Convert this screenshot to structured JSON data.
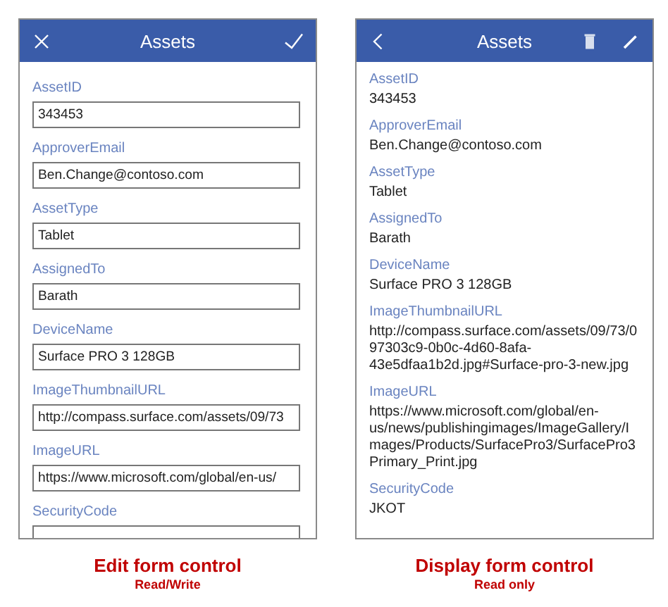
{
  "panels": [
    {
      "kind": "edit",
      "title": "Assets",
      "left_icon": {
        "kind": "close"
      },
      "right_icons": [
        {
          "kind": "check"
        }
      ],
      "fields": [
        {
          "label": "AssetID",
          "value": "343453"
        },
        {
          "label": "ApproverEmail",
          "value": "Ben.Change@contoso.com"
        },
        {
          "label": "AssetType",
          "value": "Tablet"
        },
        {
          "label": "AssignedTo",
          "value": "Barath"
        },
        {
          "label": "DeviceName",
          "value": "Surface PRO 3 128GB"
        },
        {
          "label": "ImageThumbnailURL",
          "value": "http://compass.surface.com/assets/09/73"
        },
        {
          "label": "ImageURL",
          "value": "https://www.microsoft.com/global/en-us/"
        },
        {
          "label": "SecurityCode"
        }
      ],
      "caption": "Edit form control",
      "subcaption": "Read/Write"
    },
    {
      "kind": "display",
      "title": "Assets",
      "left_icon": {
        "kind": "back"
      },
      "right_icons": [
        {
          "kind": "delete"
        },
        {
          "kind": "edit"
        }
      ],
      "fields": [
        {
          "label": "AssetID",
          "value": "343453"
        },
        {
          "label": "ApproverEmail",
          "value": "Ben.Change@contoso.com"
        },
        {
          "label": "AssetType",
          "value": "Tablet"
        },
        {
          "label": "AssignedTo",
          "value": "Barath"
        },
        {
          "label": "DeviceName",
          "value": "Surface PRO 3 128GB"
        },
        {
          "label": "ImageThumbnailURL",
          "value": "http://compass.surface.com/assets/09/73/097303c9-0b0c-4d60-8afa-43e5dfaa1b2d.jpg#Surface-pro-3-new.jpg"
        },
        {
          "label": "ImageURL",
          "value": "https://www.microsoft.com/global/en-us/news/publishingimages/ImageGallery/Images/Products/SurfacePro3/SurfacePro3Primary_Print.jpg"
        },
        {
          "label": "SecurityCode",
          "value": "JKOT"
        }
      ],
      "caption": "Display form control",
      "subcaption": "Read only"
    }
  ]
}
